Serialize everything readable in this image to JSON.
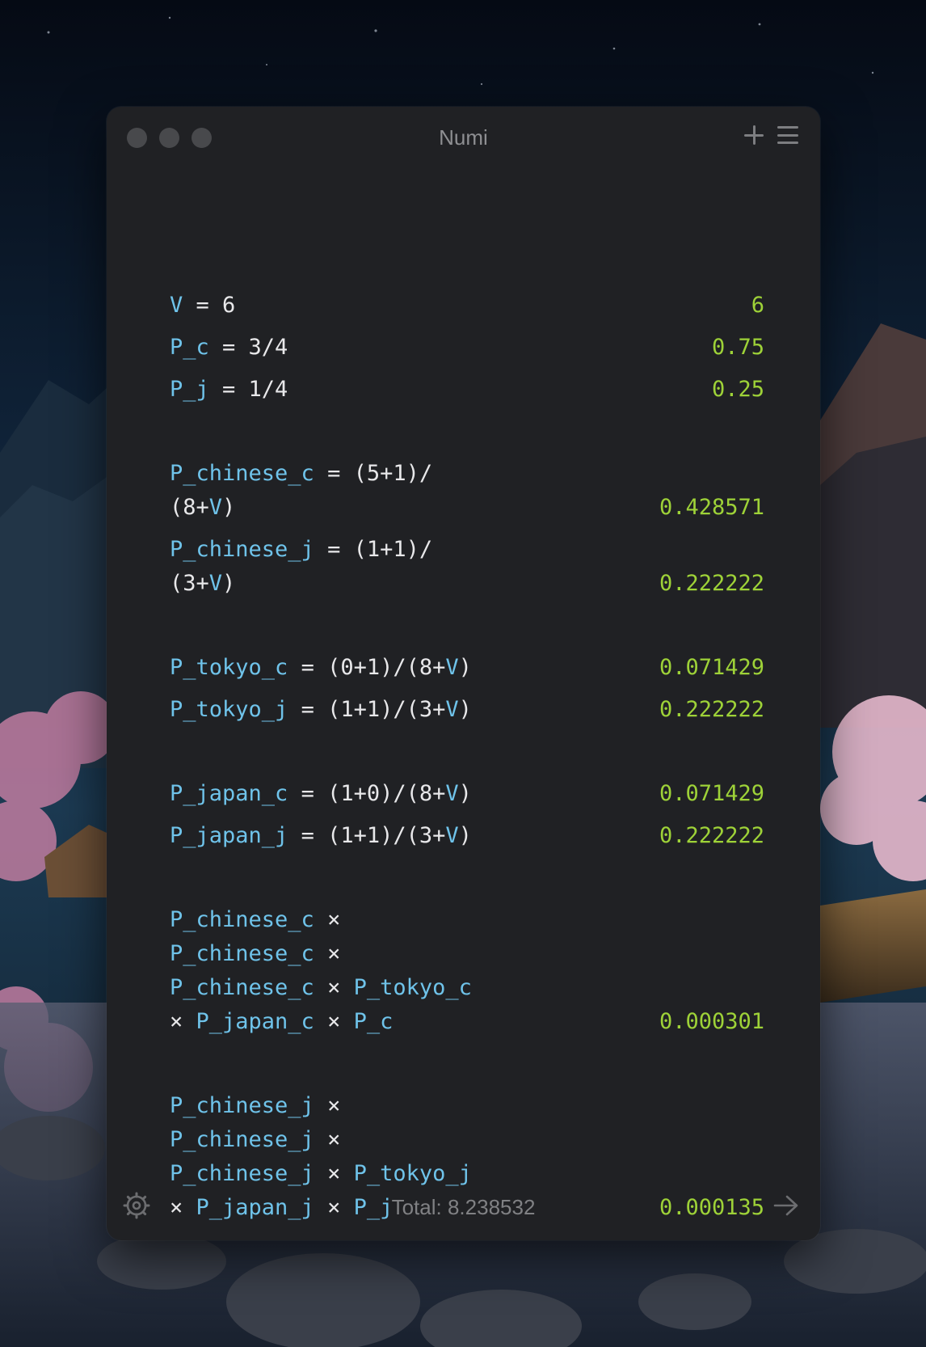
{
  "window": {
    "title": "Numi",
    "icons": {
      "new": "plus-icon",
      "menu": "menu-icon",
      "settings": "gear-icon",
      "share": "arrow-right-icon"
    }
  },
  "colors": {
    "window_bg": "#202124",
    "variable": "#6fc3ea",
    "operator": "#e8e8ea",
    "result": "#9ed238",
    "muted": "#808184"
  },
  "lines": [
    {
      "lines": [
        "V = 6"
      ],
      "result": "6"
    },
    {
      "lines": [
        "P_c = 3/4"
      ],
      "result": "0.75"
    },
    {
      "lines": [
        "P_j = 1/4"
      ],
      "result": "0.25"
    },
    {
      "blank": true
    },
    {
      "lines": [
        "P_chinese_c = (5+1)/",
        "(8+V)"
      ],
      "result": "0.428571"
    },
    {
      "lines": [
        "P_chinese_j = (1+1)/",
        "(3+V)"
      ],
      "result": "0.222222"
    },
    {
      "blank": true
    },
    {
      "lines": [
        "P_tokyo_c = (0+1)/(8+V)"
      ],
      "result": "0.071429"
    },
    {
      "lines": [
        "P_tokyo_j = (1+1)/(3+V)"
      ],
      "result": "0.222222"
    },
    {
      "blank": true
    },
    {
      "lines": [
        "P_japan_c = (1+0)/(8+V)"
      ],
      "result": "0.071429"
    },
    {
      "lines": [
        "P_japan_j = (1+1)/(3+V)"
      ],
      "result": "0.222222"
    },
    {
      "blank": true
    },
    {
      "lines": [
        "P_chinese_c ×",
        "P_chinese_c ×",
        "P_chinese_c × P_tokyo_c",
        "× P_japan_c × P_c"
      ],
      "result": "0.000301"
    },
    {
      "blank": true
    },
    {
      "lines": [
        "P_chinese_j ×",
        "P_chinese_j ×",
        "P_chinese_j × P_tokyo_j",
        "× P_japan_j × P_j"
      ],
      "result": "0.000135"
    }
  ],
  "footer": {
    "total": "Total: 8.238532"
  }
}
